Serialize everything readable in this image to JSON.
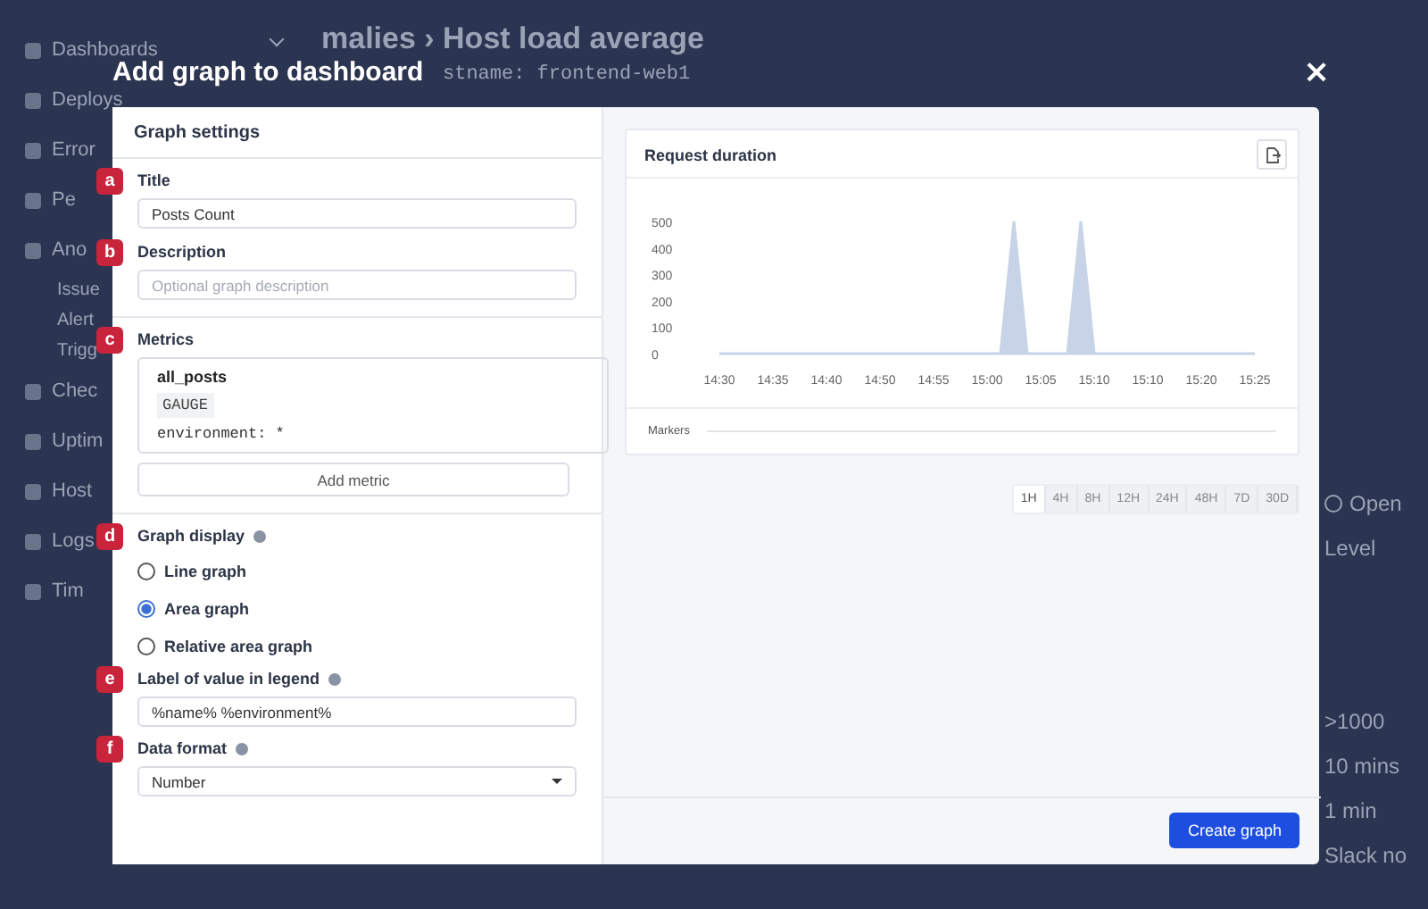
{
  "background": {
    "sidebar": [
      {
        "label": "Dashboards",
        "kind": "main",
        "expanded": true
      },
      {
        "label": "Deploys",
        "kind": "main"
      },
      {
        "label": "Error",
        "kind": "main"
      },
      {
        "label": "Pe",
        "kind": "main"
      },
      {
        "label": "Ano",
        "kind": "main"
      },
      {
        "label": "Issue",
        "kind": "sub"
      },
      {
        "label": "Alert",
        "kind": "sub"
      },
      {
        "label": "Trigg",
        "kind": "sub"
      },
      {
        "label": "Chec",
        "kind": "main"
      },
      {
        "label": "Uptim",
        "kind": "main"
      },
      {
        "label": "Host",
        "kind": "main"
      },
      {
        "label": "Logs",
        "kind": "main"
      },
      {
        "label": "Tim",
        "kind": "main"
      }
    ],
    "breadcrumb": "malies › Host load average",
    "subtitle": "stname: frontend-web1",
    "right_items": [
      {
        "label": "Open",
        "kind": "status"
      },
      {
        "label": "Level",
        "kind": "text"
      },
      {
        "label": ">1000",
        "kind": "text"
      },
      {
        "label": "10 mins",
        "kind": "text"
      },
      {
        "label": "1 min",
        "kind": "text"
      },
      {
        "label": "Slack no",
        "kind": "text"
      }
    ]
  },
  "modal": {
    "title": "Add graph to dashboard",
    "close": "×",
    "settings": {
      "heading": "Graph settings",
      "title_field": {
        "badge": "a",
        "label": "Title",
        "value": "Posts Count"
      },
      "description_field": {
        "badge": "b",
        "label": "Description",
        "placeholder": "Optional graph description"
      },
      "metrics": {
        "badge": "c",
        "label": "Metrics",
        "items": [
          {
            "name": "all_posts",
            "type": "GAUGE",
            "tags": "environment: *"
          }
        ],
        "add_button": "Add metric"
      },
      "display": {
        "badge": "d",
        "label": "Graph display",
        "options": [
          {
            "label": "Line graph",
            "selected": false
          },
          {
            "label": "Area graph",
            "selected": true
          },
          {
            "label": "Relative area graph",
            "selected": false
          }
        ]
      },
      "legend_field": {
        "badge": "e",
        "label": "Label of value in legend",
        "value": "%name% %environment%"
      },
      "format_field": {
        "badge": "f",
        "label": "Data format",
        "value": "Number"
      }
    },
    "preview": {
      "title": "Request duration",
      "markers_label": "Markers",
      "chart_data": {
        "type": "area",
        "categories": [
          "14:30",
          null,
          null,
          null,
          "14:35",
          null,
          null,
          null,
          "14:40",
          null,
          null,
          null,
          "14:50",
          null,
          null,
          null,
          "14:55",
          null,
          null,
          null,
          "15:00",
          null,
          null,
          null,
          "15:05",
          null,
          null,
          null,
          "15:10",
          null,
          null,
          null,
          "15:10",
          null,
          null,
          null,
          "15:20",
          null,
          null,
          null,
          "15:25"
        ],
        "series": [
          {
            "color": "#c7d3e6",
            "values": [
              0,
              0,
              0,
              0,
              0,
              0,
              0,
              0,
              0,
              0,
              0,
              0,
              0,
              0,
              0,
              0,
              0,
              0,
              0,
              0,
              0,
              0,
              500,
              0,
              0,
              0,
              0,
              500,
              0,
              0,
              0,
              0,
              0,
              0,
              0,
              0,
              0,
              0,
              0,
              0,
              0
            ]
          }
        ],
        "yticks": [
          0,
          100,
          200,
          300,
          400,
          500
        ],
        "ylim": [
          0,
          500
        ]
      },
      "ranges": [
        {
          "label": "1H",
          "selected": true
        },
        {
          "label": "4H",
          "selected": false
        },
        {
          "label": "8H",
          "selected": false
        },
        {
          "label": "12H",
          "selected": false
        },
        {
          "label": "24H",
          "selected": false
        },
        {
          "label": "48H",
          "selected": false
        },
        {
          "label": "7D",
          "selected": false
        },
        {
          "label": "30D",
          "selected": false
        }
      ]
    },
    "create_button": "Create graph"
  }
}
